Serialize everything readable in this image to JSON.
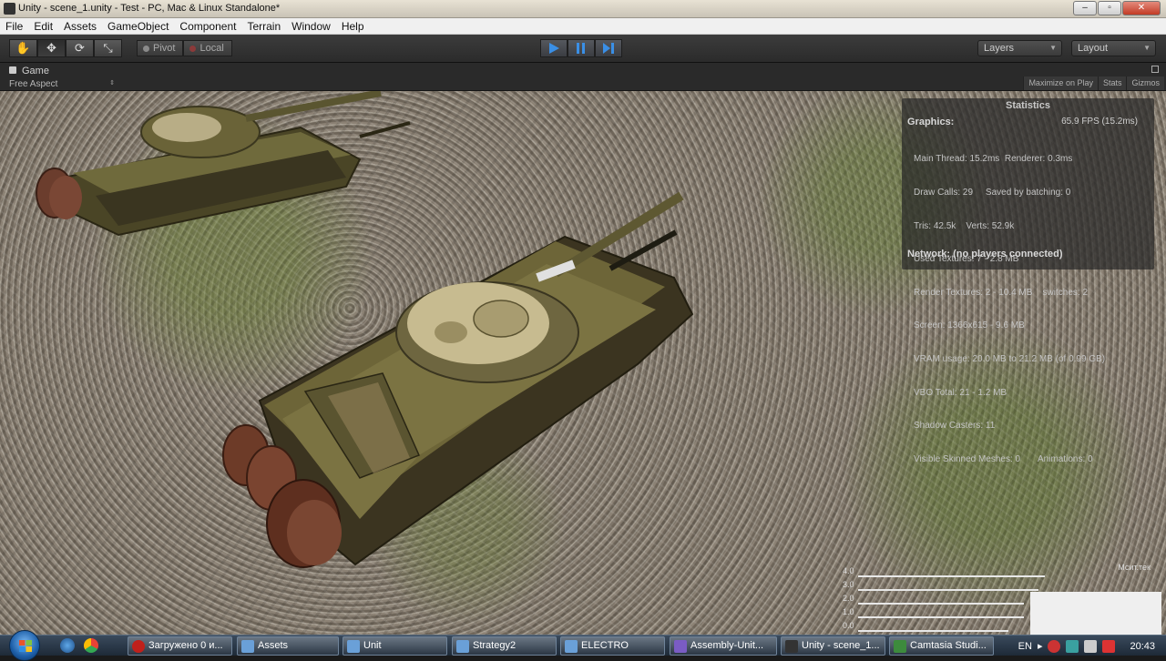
{
  "window": {
    "title": "Unity - scene_1.unity - Test - PC, Mac & Linux Standalone*",
    "controls": [
      "minimize",
      "maximize",
      "close"
    ]
  },
  "menu": [
    "File",
    "Edit",
    "Assets",
    "GameObject",
    "Component",
    "Terrain",
    "Window",
    "Help"
  ],
  "toolbar": {
    "tools": [
      "hand-icon",
      "move-icon",
      "rotate-icon",
      "scale-icon"
    ],
    "pivot_label": "Pivot",
    "local_label": "Local",
    "play_controls": [
      "play-icon",
      "pause-icon",
      "step-icon"
    ],
    "layers_label": "Layers",
    "layout_label": "Layout"
  },
  "game_panel": {
    "tab_label": "Game",
    "aspect_label": "Free Aspect",
    "options": [
      "Maximize on Play",
      "Stats",
      "Gizmos"
    ]
  },
  "statistics": {
    "title": "Statistics",
    "graphics_label": "Graphics:",
    "fps": "65.9 FPS (15.2ms)",
    "lines": [
      "Main Thread: 15.2ms  Renderer: 0.3ms",
      "Draw Calls: 29     Saved by batching: 0",
      "Tris: 42.5k    Verts: 52.9k",
      "Used Textures: 7 - 2.8 MB",
      "Render Textures: 2 - 10.4 MB    switches: 2",
      "Screen: 1366x615 - 9.6 MB",
      "VRAM usage: 20.0 MB to 21.2 MB (of 0.99 GB)",
      "VBO Total: 21 - 1.2 MB",
      "Shadow Casters: 11",
      "Visible Skinned Meshes: 0       Animations: 0"
    ],
    "network": "Network: (no players connected)"
  },
  "meter": {
    "label": "Мсит.тек",
    "rows": [
      "4.0",
      "3.0",
      "2.0",
      "1.0",
      "0.0"
    ],
    "levels": [
      0.62,
      0.6,
      0.55,
      0.55,
      0.5
    ]
  },
  "taskbar": {
    "buttons": [
      {
        "label": "Загружено 0 и...",
        "color": "#c0201b"
      },
      {
        "label": "Assets",
        "color": "#6aa0d8"
      },
      {
        "label": "Unit",
        "color": "#6aa0d8"
      },
      {
        "label": "Strategy2",
        "color": "#6aa0d8"
      },
      {
        "label": "ELECTRO",
        "color": "#6aa0d8"
      },
      {
        "label": "Assembly-Unit...",
        "color": "#7a5cc4"
      },
      {
        "label": "Unity - scene_1...",
        "color": "#333333"
      },
      {
        "label": "Camtasia Studi...",
        "color": "#3d8b3d"
      }
    ],
    "language": "EN",
    "clock": "20:43"
  }
}
